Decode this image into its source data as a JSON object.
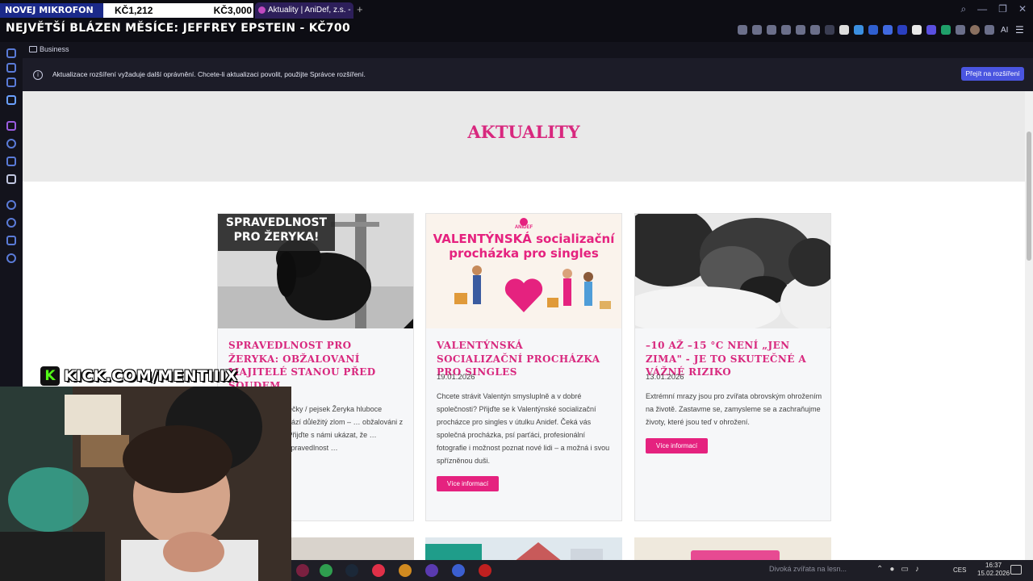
{
  "stream_overlay": {
    "goal_label": "NOVEJ MIKROFON",
    "goal_current": "KČ1,212",
    "goal_target": "KČ3,000",
    "goal_progress": 0.404,
    "subtitle": "NEJVĚTŠÍ BLÁZEN MĚSÍCE: JEFFREY EPSTEIN - KČ700",
    "kick_handle": "KICK.COM/MENTIIIX"
  },
  "browser": {
    "tab_title": "Aktuality | AniDef, z.s. - út",
    "ai_label": "AI",
    "bookmark_folder": "Business",
    "notification": {
      "text": "Aktualizace rozšíření vyžaduje další oprávnění. Chcete-li aktualizaci povolit, použijte Správce rozšíření.",
      "button": "Přejít na rozšíření"
    }
  },
  "page": {
    "heading": "AKTUALITY",
    "cards": [
      {
        "image_caption": "SPRAVEDLNOST PRO ŽERYKA!",
        "title": "SPRAVEDLNOST PRO ŽERYKA: OBŽALOVANÍ MAJITELÉ STANOU PŘED SOUDEM",
        "date": "",
        "body": "Případ pejsk… fenečky / pejsek Žeryka hluboce zasáhl… Nyní přichází důležitý zlom – … obžalováni z týrání zvířete a … Přijďte s námi ukázat, že … nezapomněli a že spravedlnost …",
        "button": ""
      },
      {
        "image_caption": "VALENTÝNSKÁ socializační procházka pro singles",
        "image_brand": "ANIDEF",
        "title": "VALENTÝNSKÁ SOCIALIZAČNÍ PROCHÁZKA PRO SINGLES",
        "date": "19.01.2026",
        "body": "Chcete strávit Valentýn smysluplně a v dobré společnosti? Přijďte se k Valentýnské socializační procházce pro singles v útulku Anidef. Čeká vás společná procházka, psí parťáci, profesionální fotografie i možnost poznat nové lidi – a možná i svou spřízněnou duši.",
        "button": "Více informací"
      },
      {
        "image_caption": "",
        "title": "–10 AŽ –15 °C NENÍ „JEN ZIMA\" - JE TO SKUTEČNÉ A VÁŽNÉ RIZIKO",
        "date": "13.01.2026",
        "body": "Extrémní mrazy jsou pro zvířata obrovským ohrožením na životě. Zastavme se, zamysleme se a zachraňujme životy, které jsou teď v ohrožení.",
        "button": "Více informací"
      }
    ]
  },
  "taskbar": {
    "search_text": "Divoká zvířata na lesn...",
    "language": "CES",
    "time": "16:37",
    "date": "15.02.2026"
  },
  "colors": {
    "accent_pink": "#d8287e",
    "button_pink": "#e5227f",
    "notice_button": "#4a55e0",
    "kick_green": "#53fc18"
  }
}
